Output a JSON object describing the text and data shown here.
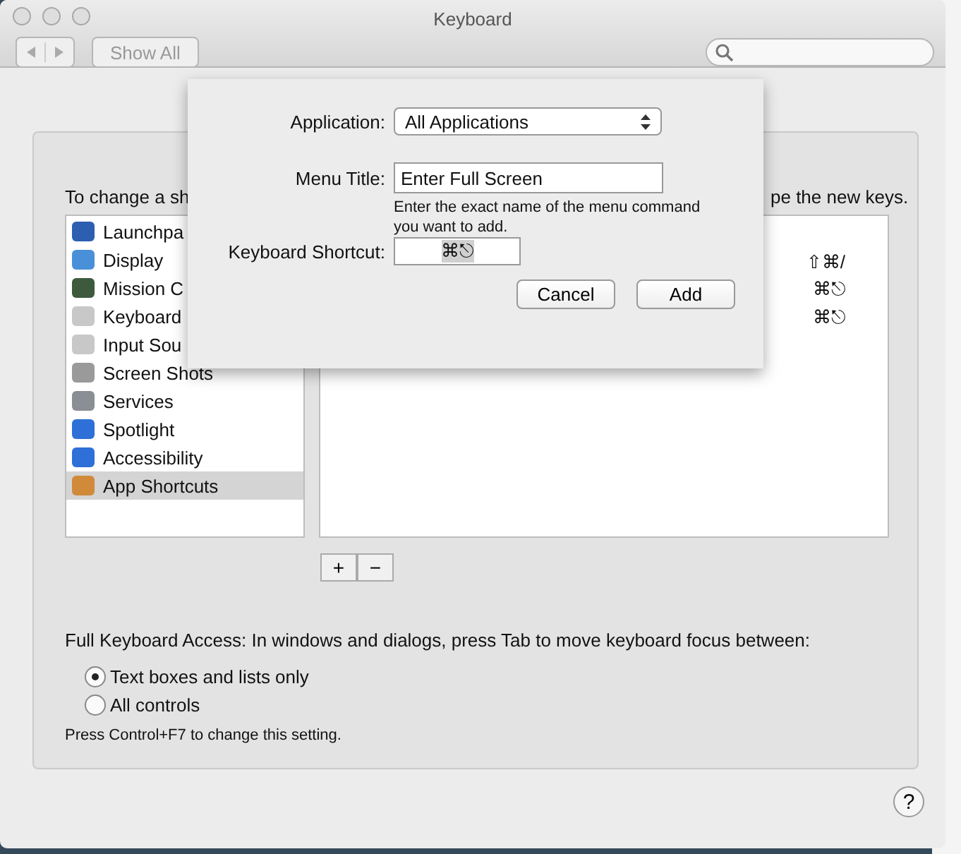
{
  "window": {
    "title": "Keyboard"
  },
  "toolbar": {
    "show_all": "Show All"
  },
  "instruction": [
    "To change a sh",
    "pe the new keys."
  ],
  "categories": [
    {
      "label": "Launchpa",
      "selected": false
    },
    {
      "label": "Display",
      "selected": false
    },
    {
      "label": "Mission C",
      "selected": false
    },
    {
      "label": "Keyboard",
      "selected": false
    },
    {
      "label": "Input Sou",
      "selected": false
    },
    {
      "label": "Screen Shots",
      "selected": false
    },
    {
      "label": "Services",
      "selected": false
    },
    {
      "label": "Spotlight",
      "selected": false
    },
    {
      "label": "Accessibility",
      "selected": false
    },
    {
      "label": "App Shortcuts",
      "selected": true
    }
  ],
  "shortcut_keys": [
    "⇧⌘/",
    "⌘⎋",
    "⌘⎋"
  ],
  "list_buttons": [
    "+",
    "−"
  ],
  "keyboard_access": {
    "text": "Full Keyboard Access: In windows and dialogs, press Tab to move keyboard focus between:",
    "options": [
      {
        "label": "Text boxes and lists only",
        "selected": true
      },
      {
        "label": "All controls",
        "selected": false
      }
    ],
    "note": "Press Control+F7 to change this setting."
  },
  "help": "?",
  "sheet": {
    "application_label": "Application:",
    "application_value": "All Applications",
    "menu_title_label": "Menu Title:",
    "menu_title_value": "Enter Full Screen",
    "hint": "Enter the exact name of the menu command you want to add.",
    "shortcut_label": "Keyboard Shortcut:",
    "shortcut_value": "⌘⎋",
    "buttons": [
      "Cancel",
      "Add"
    ]
  }
}
